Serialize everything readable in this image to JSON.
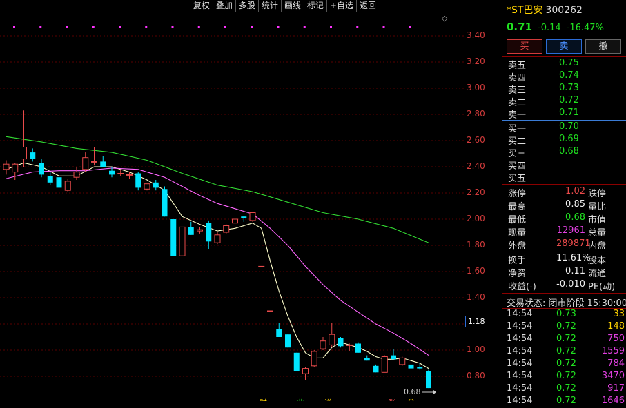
{
  "toolbar": [
    "复权",
    "叠加",
    "多股",
    "统计",
    "画线",
    "标记",
    "+自选",
    "返回"
  ],
  "diamond_glyph": "◇",
  "price_axis": {
    "ticks": [
      "3.40",
      "3.20",
      "3.00",
      "2.80",
      "2.60",
      "2.40",
      "2.20",
      "2.00",
      "1.80",
      "1.60",
      "1.40",
      "1.20",
      "1.00",
      "0.80"
    ],
    "current_tag": "1.18",
    "min_label": "0.68"
  },
  "bottom_markers": [
    "财",
    "业",
    "谱",
    "张",
    "分"
  ],
  "chart_data": {
    "type": "candlestick",
    "y_range": [
      0.7,
      3.5
    ],
    "up_color": "#e84a4a",
    "down_color": "#00e5ff",
    "candles": [
      {
        "o": 2.38,
        "h": 2.45,
        "l": 2.34,
        "c": 2.42
      },
      {
        "o": 2.36,
        "h": 2.43,
        "l": 2.3,
        "c": 2.42
      },
      {
        "o": 2.46,
        "h": 2.83,
        "l": 2.4,
        "c": 2.55
      },
      {
        "o": 2.51,
        "h": 2.54,
        "l": 2.44,
        "c": 2.46
      },
      {
        "o": 2.43,
        "h": 2.46,
        "l": 2.32,
        "c": 2.34
      },
      {
        "o": 2.33,
        "h": 2.36,
        "l": 2.26,
        "c": 2.28
      },
      {
        "o": 2.32,
        "h": 2.34,
        "l": 2.22,
        "c": 2.24
      },
      {
        "o": 2.22,
        "h": 2.31,
        "l": 2.21,
        "c": 2.29
      },
      {
        "o": 2.32,
        "h": 2.4,
        "l": 2.3,
        "c": 2.36
      },
      {
        "o": 2.38,
        "h": 2.51,
        "l": 2.36,
        "c": 2.47
      },
      {
        "o": 2.44,
        "h": 2.55,
        "l": 2.41,
        "c": 2.44
      },
      {
        "o": 2.44,
        "h": 2.48,
        "l": 2.4,
        "c": 2.4
      },
      {
        "o": 2.37,
        "h": 2.4,
        "l": 2.32,
        "c": 2.34
      },
      {
        "o": 2.35,
        "h": 2.38,
        "l": 2.33,
        "c": 2.35
      },
      {
        "o": 2.34,
        "h": 2.36,
        "l": 2.31,
        "c": 2.34
      },
      {
        "o": 2.35,
        "h": 2.36,
        "l": 2.22,
        "c": 2.24
      },
      {
        "o": 2.23,
        "h": 2.27,
        "l": 2.22,
        "c": 2.27
      },
      {
        "o": 2.28,
        "h": 2.3,
        "l": 2.22,
        "c": 2.24
      },
      {
        "o": 2.23,
        "h": 2.25,
        "l": 2.02,
        "c": 2.02
      },
      {
        "o": 2.0,
        "h": 2.0,
        "l": 1.72,
        "c": 1.72
      },
      {
        "o": 1.72,
        "h": 1.94,
        "l": 1.72,
        "c": 1.94
      },
      {
        "o": 1.94,
        "h": 1.98,
        "l": 1.88,
        "c": 1.88
      },
      {
        "o": 1.91,
        "h": 1.94,
        "l": 1.89,
        "c": 1.92
      },
      {
        "o": 1.97,
        "h": 1.99,
        "l": 1.77,
        "c": 1.83
      },
      {
        "o": 1.82,
        "h": 1.9,
        "l": 1.81,
        "c": 1.88
      },
      {
        "o": 1.9,
        "h": 1.96,
        "l": 1.89,
        "c": 1.95
      },
      {
        "o": 1.97,
        "h": 2.01,
        "l": 1.95,
        "c": 2.0
      },
      {
        "o": 2.02,
        "h": 2.02,
        "l": 1.98,
        "c": 2.01
      },
      {
        "o": 1.99,
        "h": 2.05,
        "l": 1.98,
        "c": 2.05
      },
      {
        "o": 1.64,
        "h": 1.64,
        "l": 1.64,
        "c": 1.64
      },
      {
        "o": 1.3,
        "h": 1.3,
        "l": 1.3,
        "c": 1.3
      },
      {
        "o": 1.16,
        "h": 1.21,
        "l": 1.1,
        "c": 1.1
      },
      {
        "o": 1.12,
        "h": 1.12,
        "l": 1.02,
        "c": 1.02
      },
      {
        "o": 0.98,
        "h": 0.98,
        "l": 0.84,
        "c": 0.84
      },
      {
        "o": 0.82,
        "h": 0.87,
        "l": 0.77,
        "c": 0.86
      },
      {
        "o": 0.88,
        "h": 1.0,
        "l": 0.87,
        "c": 0.99
      },
      {
        "o": 1.01,
        "h": 1.1,
        "l": 1.0,
        "c": 1.07
      },
      {
        "o": 1.04,
        "h": 1.21,
        "l": 1.02,
        "c": 1.12
      },
      {
        "o": 1.09,
        "h": 1.1,
        "l": 1.02,
        "c": 1.03
      },
      {
        "o": 1.04,
        "h": 1.05,
        "l": 0.99,
        "c": 1.04
      },
      {
        "o": 1.05,
        "h": 1.06,
        "l": 0.98,
        "c": 0.98
      },
      {
        "o": 0.94,
        "h": 0.96,
        "l": 0.92,
        "c": 0.92
      },
      {
        "o": 0.88,
        "h": 0.89,
        "l": 0.83,
        "c": 0.83
      },
      {
        "o": 0.83,
        "h": 0.96,
        "l": 0.83,
        "c": 0.95
      },
      {
        "o": 0.96,
        "h": 1.01,
        "l": 0.94,
        "c": 0.93
      },
      {
        "o": 0.89,
        "h": 0.95,
        "l": 0.88,
        "c": 0.94
      },
      {
        "o": 0.89,
        "h": 0.9,
        "l": 0.86,
        "c": 0.86
      },
      {
        "o": 0.87,
        "h": 0.9,
        "l": 0.85,
        "c": 0.86
      },
      {
        "o": 0.84,
        "h": 0.85,
        "l": 0.71,
        "c": 0.71
      }
    ],
    "ma": [
      {
        "color": "#ffffcc",
        "points": [
          [
            0,
            2.38
          ],
          [
            2,
            2.43
          ],
          [
            4,
            2.4
          ],
          [
            6,
            2.33
          ],
          [
            8,
            2.33
          ],
          [
            10,
            2.4
          ],
          [
            12,
            2.4
          ],
          [
            14,
            2.36
          ],
          [
            16,
            2.3
          ],
          [
            18,
            2.22
          ],
          [
            20,
            2.02
          ],
          [
            22,
            1.96
          ],
          [
            24,
            1.91
          ],
          [
            26,
            1.93
          ],
          [
            28,
            1.97
          ],
          [
            29,
            1.93
          ],
          [
            30,
            1.68
          ],
          [
            31,
            1.45
          ],
          [
            32,
            1.26
          ],
          [
            33,
            1.1
          ],
          [
            34,
            0.98
          ],
          [
            35,
            0.94
          ],
          [
            36,
            0.94
          ],
          [
            37,
            1.02
          ],
          [
            38,
            1.06
          ],
          [
            39,
            1.04
          ],
          [
            40,
            1.02
          ],
          [
            41,
            0.99
          ],
          [
            42,
            0.95
          ],
          [
            43,
            0.93
          ],
          [
            44,
            0.93
          ],
          [
            45,
            0.94
          ],
          [
            46,
            0.92
          ],
          [
            47,
            0.9
          ],
          [
            48,
            0.86
          ]
        ]
      },
      {
        "color": "#ff66ff",
        "points": [
          [
            0,
            2.31
          ],
          [
            3,
            2.36
          ],
          [
            6,
            2.37
          ],
          [
            9,
            2.37
          ],
          [
            12,
            2.39
          ],
          [
            15,
            2.38
          ],
          [
            18,
            2.32
          ],
          [
            20,
            2.25
          ],
          [
            22,
            2.18
          ],
          [
            24,
            2.12
          ],
          [
            26,
            2.08
          ],
          [
            28,
            2.04
          ],
          [
            30,
            1.93
          ],
          [
            32,
            1.8
          ],
          [
            34,
            1.64
          ],
          [
            36,
            1.5
          ],
          [
            38,
            1.38
          ],
          [
            40,
            1.29
          ],
          [
            42,
            1.2
          ],
          [
            44,
            1.13
          ],
          [
            46,
            1.05
          ],
          [
            48,
            0.96
          ]
        ]
      },
      {
        "color": "#33dd33",
        "points": [
          [
            0,
            2.63
          ],
          [
            4,
            2.59
          ],
          [
            8,
            2.54
          ],
          [
            12,
            2.51
          ],
          [
            16,
            2.45
          ],
          [
            20,
            2.35
          ],
          [
            24,
            2.26
          ],
          [
            28,
            2.21
          ],
          [
            32,
            2.13
          ],
          [
            36,
            2.05
          ],
          [
            40,
            2.0
          ],
          [
            44,
            1.93
          ],
          [
            48,
            1.82
          ]
        ]
      }
    ]
  },
  "quote": {
    "name": "*ST巴安",
    "code": "300262",
    "price": "0.71",
    "change": "-0.14",
    "change_pct": "-16.47%"
  },
  "trade_buttons": {
    "buy": "买",
    "sell": "卖",
    "cancel": "撤"
  },
  "sell_book": [
    {
      "label": "卖五",
      "price": "0.75",
      "vol": ""
    },
    {
      "label": "卖四",
      "price": "0.74",
      "vol": ""
    },
    {
      "label": "卖三",
      "price": "0.73",
      "vol": ""
    },
    {
      "label": "卖二",
      "price": "0.72",
      "vol": ""
    },
    {
      "label": "卖一",
      "price": "0.71",
      "vol": ""
    }
  ],
  "buy_book": [
    {
      "label": "买一",
      "price": "0.70",
      "vol": ""
    },
    {
      "label": "买二",
      "price": "0.69",
      "vol": ""
    },
    {
      "label": "买三",
      "price": "0.68",
      "vol": ""
    },
    {
      "label": "买四",
      "price": "",
      "vol": ""
    },
    {
      "label": "买五",
      "price": "",
      "vol": ""
    }
  ],
  "stats": [
    {
      "l1": "涨停",
      "v1": "1.02",
      "v1_class": "red",
      "l2": "跌停"
    },
    {
      "l1": "最高",
      "v1": "0.85",
      "v1_class": "white",
      "l2": "量比"
    },
    {
      "l1": "最低",
      "v1": "0.68",
      "v1_class": "green boxed",
      "l2": "市值"
    },
    {
      "l1": "现量",
      "v1": "12961",
      "v1_class": "magenta",
      "l2": "总量"
    },
    {
      "l1": "外盘",
      "v1": "289871",
      "v1_class": "red",
      "l2": "内盘"
    }
  ],
  "stats2": [
    {
      "l1": "换手",
      "v1": "11.61%",
      "v1_class": "white",
      "l2": "股本"
    },
    {
      "l1": "净资",
      "v1": "0.11",
      "v1_class": "white",
      "l2": "流通"
    },
    {
      "l1": "收益(-)",
      "v1": "-0.010",
      "v1_class": "white",
      "l2": "PE(动)"
    }
  ],
  "trade_state": "交易状态: 闭市阶段 15:30:00",
  "ticks": [
    {
      "time": "14:54",
      "price": "0.73",
      "vol": "33",
      "vol_color": "yellow"
    },
    {
      "time": "14:54",
      "price": "0.72",
      "vol": "148",
      "vol_color": "yellow"
    },
    {
      "time": "14:54",
      "price": "0.72",
      "vol": "750",
      "vol_color": "magenta"
    },
    {
      "time": "14:54",
      "price": "0.72",
      "vol": "1559",
      "vol_color": "magenta"
    },
    {
      "time": "14:54",
      "price": "0.72",
      "vol": "784",
      "vol_color": "magenta"
    },
    {
      "time": "14:54",
      "price": "0.72",
      "vol": "3470",
      "vol_color": "magenta"
    },
    {
      "time": "14:54",
      "price": "0.72",
      "vol": "917",
      "vol_color": "magenta"
    },
    {
      "time": "14:54",
      "price": "0.72",
      "vol": "1646",
      "vol_color": "magenta"
    }
  ]
}
